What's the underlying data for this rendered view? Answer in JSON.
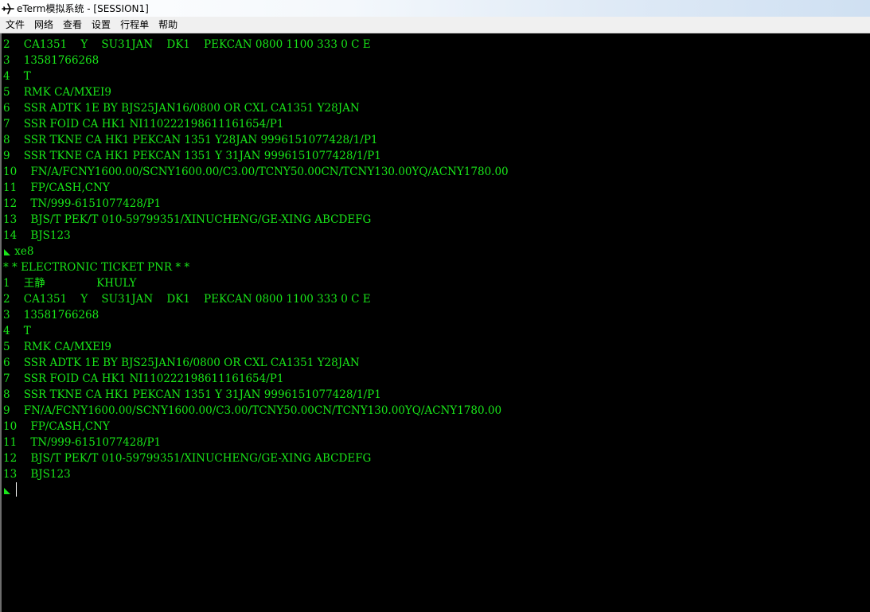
{
  "window": {
    "title": "eTerm模拟系统 - [SESSION1]"
  },
  "menu": [
    {
      "label": "文件"
    },
    {
      "label": "网络"
    },
    {
      "label": "查看"
    },
    {
      "label": "设置"
    },
    {
      "label": "行程单"
    },
    {
      "label": "帮助"
    }
  ],
  "terminal": {
    "lines": [
      "2    CA1351    Y    SU31JAN    DK1    PEKCAN 0800 1100 333 0 C E",
      "3    13581766268",
      "4    T",
      "5    RMK CA/MXEI9",
      "6    SSR ADTK 1E BY BJS25JAN16/0800 OR CXL CA1351 Y28JAN",
      "7    SSR FOID CA HK1 NI110222198611161654/P1",
      "8    SSR TKNE CA HK1 PEKCAN 1351 Y28JAN 9996151077428/1/P1",
      "9    SSR TKNE CA HK1 PEKCAN 1351 Y 31JAN 9996151077428/1/P1",
      "10    FN/A/FCNY1600.00/SCNY1600.00/C3.00/TCNY50.00CN/TCNY130.00YQ/ACNY1780.00",
      "11    FP/CASH,CNY",
      "12    TN/999-6151077428/P1",
      "13    BJS/T PEK/T 010-59799351/XINUCHENG/GE-XING ABCDEFG",
      "14    BJS123",
      " xe8",
      "* * ELECTRONIC TICKET PNR * *",
      "1    王静               KHULY",
      "2    CA1351    Y    SU31JAN    DK1    PEKCAN 0800 1100 333 0 C E",
      "3    13581766268",
      "4    T",
      "5    RMK CA/MXEI9",
      "6    SSR ADTK 1E BY BJS25JAN16/0800 OR CXL CA1351 Y28JAN",
      "7    SSR FOID CA HK1 NI110222198611161654/P1",
      "8    SSR TKNE CA HK1 PEKCAN 1351 Y 31JAN 9996151077428/1/P1",
      "9    FN/A/FCNY1600.00/SCNY1600.00/C3.00/TCNY50.00CN/TCNY130.00YQ/ACNY1780.00",
      "10    FP/CASH,CNY",
      "11    TN/999-6151077428/P1",
      "12    BJS/T PEK/T 010-59799351/XINUCHENG/GE-XING ABCDEFG",
      "13    BJS123"
    ],
    "prompt_lines": [
      13,
      28
    ]
  },
  "colors": {
    "terminal_text": "#19e619",
    "terminal_bg": "#000000",
    "prompt_mark": "#19e619"
  }
}
